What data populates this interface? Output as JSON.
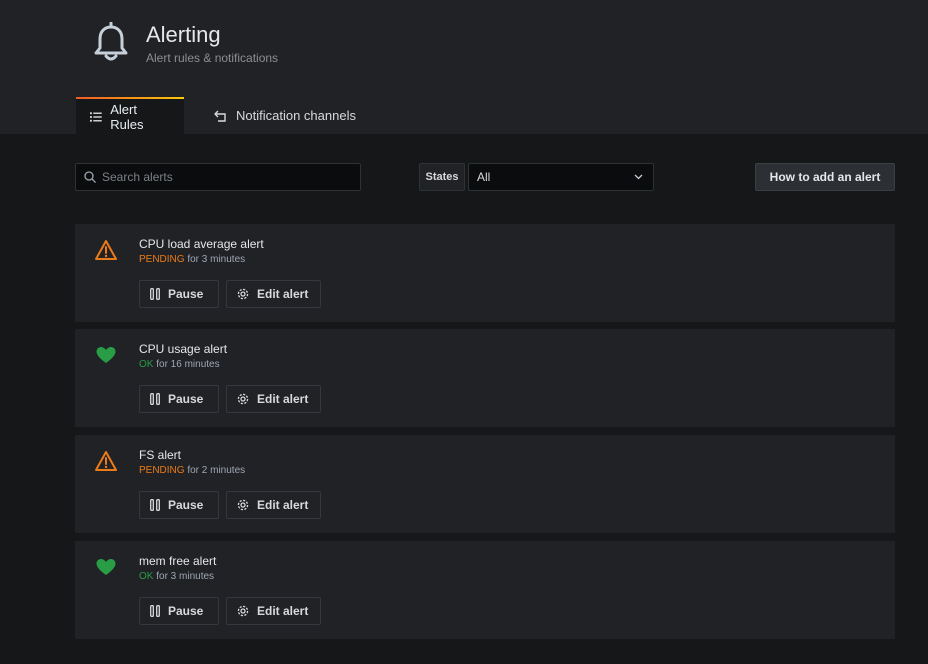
{
  "header": {
    "title": "Alerting",
    "subtitle": "Alert rules & notifications",
    "icon": "bell-icon"
  },
  "tabs": [
    {
      "label": "Alert Rules",
      "icon": "list-icon",
      "active": true
    },
    {
      "label": "Notification channels",
      "icon": "share-icon",
      "active": false
    }
  ],
  "toolbar": {
    "search_placeholder": "Search alerts",
    "search_value": "",
    "states_label": "States",
    "states_value": "All",
    "howto_label": "How to add an alert"
  },
  "colors": {
    "pending": "#eb7b18",
    "ok": "#299c46",
    "accent_gradient": [
      "#f05a28",
      "#fbca0a"
    ]
  },
  "alerts": [
    {
      "name": "CPU load average alert",
      "state": "PENDING",
      "duration": "for 3 minutes",
      "icon": "warning-icon",
      "pause_label": "Pause",
      "edit_label": "Edit alert"
    },
    {
      "name": "CPU usage alert",
      "state": "OK",
      "duration": "for 16 minutes",
      "icon": "heart-icon",
      "pause_label": "Pause",
      "edit_label": "Edit alert"
    },
    {
      "name": "FS alert",
      "state": "PENDING",
      "duration": "for 2 minutes",
      "icon": "warning-icon",
      "pause_label": "Pause",
      "edit_label": "Edit alert"
    },
    {
      "name": "mem free alert",
      "state": "OK",
      "duration": "for 3 minutes",
      "icon": "heart-icon",
      "pause_label": "Pause",
      "edit_label": "Edit alert"
    }
  ]
}
